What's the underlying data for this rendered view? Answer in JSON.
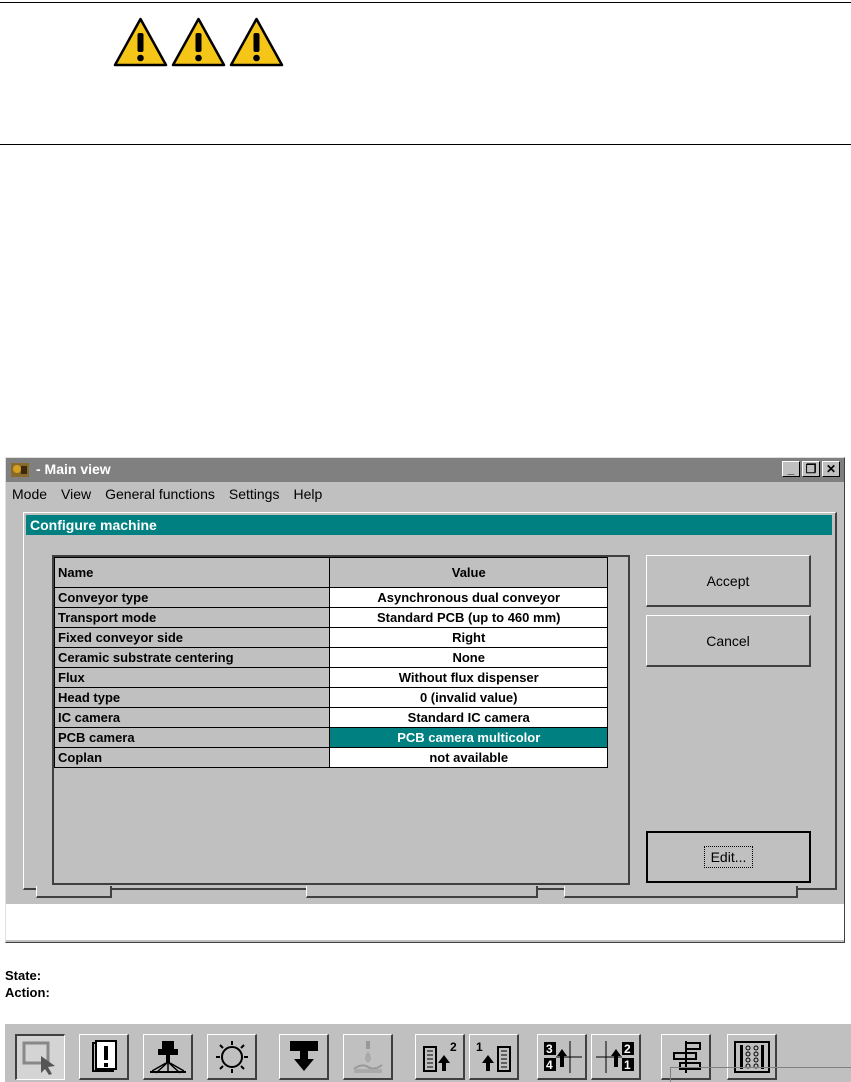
{
  "app": {
    "title": "- Main view",
    "menu": [
      "Mode",
      "View",
      "General functions",
      "Settings",
      "Help"
    ],
    "window_buttons": {
      "minimize": "_",
      "restore": "❐",
      "close": "✕"
    }
  },
  "dialog": {
    "title": "Configure machine",
    "table": {
      "headers": [
        "Name",
        "Value"
      ],
      "rows": [
        {
          "name": "Conveyor type",
          "value": "Asynchronous dual conveyor"
        },
        {
          "name": "Transport mode",
          "value": "Standard PCB (up to 460 mm)"
        },
        {
          "name": "Fixed conveyor side",
          "value": "Right"
        },
        {
          "name": "Ceramic substrate centering",
          "value": "None"
        },
        {
          "name": "Flux",
          "value": "Without flux dispenser"
        },
        {
          "name": "Head type",
          "value": "0 (invalid value)"
        },
        {
          "name": "IC camera",
          "value": "Standard IC camera"
        },
        {
          "name": "PCB camera",
          "value": "PCB camera multicolor"
        },
        {
          "name": "Coplan",
          "value": "not available"
        }
      ],
      "selected_row": "PCB camera"
    },
    "buttons": {
      "accept": "Accept",
      "cancel": "Cancel",
      "edit": "Edit..."
    }
  },
  "status": {
    "state_label": "State:",
    "action_label": "Action:"
  },
  "colors": {
    "teal": "#008080",
    "gray": "#c0c0c0",
    "warning": "#f5c518"
  }
}
